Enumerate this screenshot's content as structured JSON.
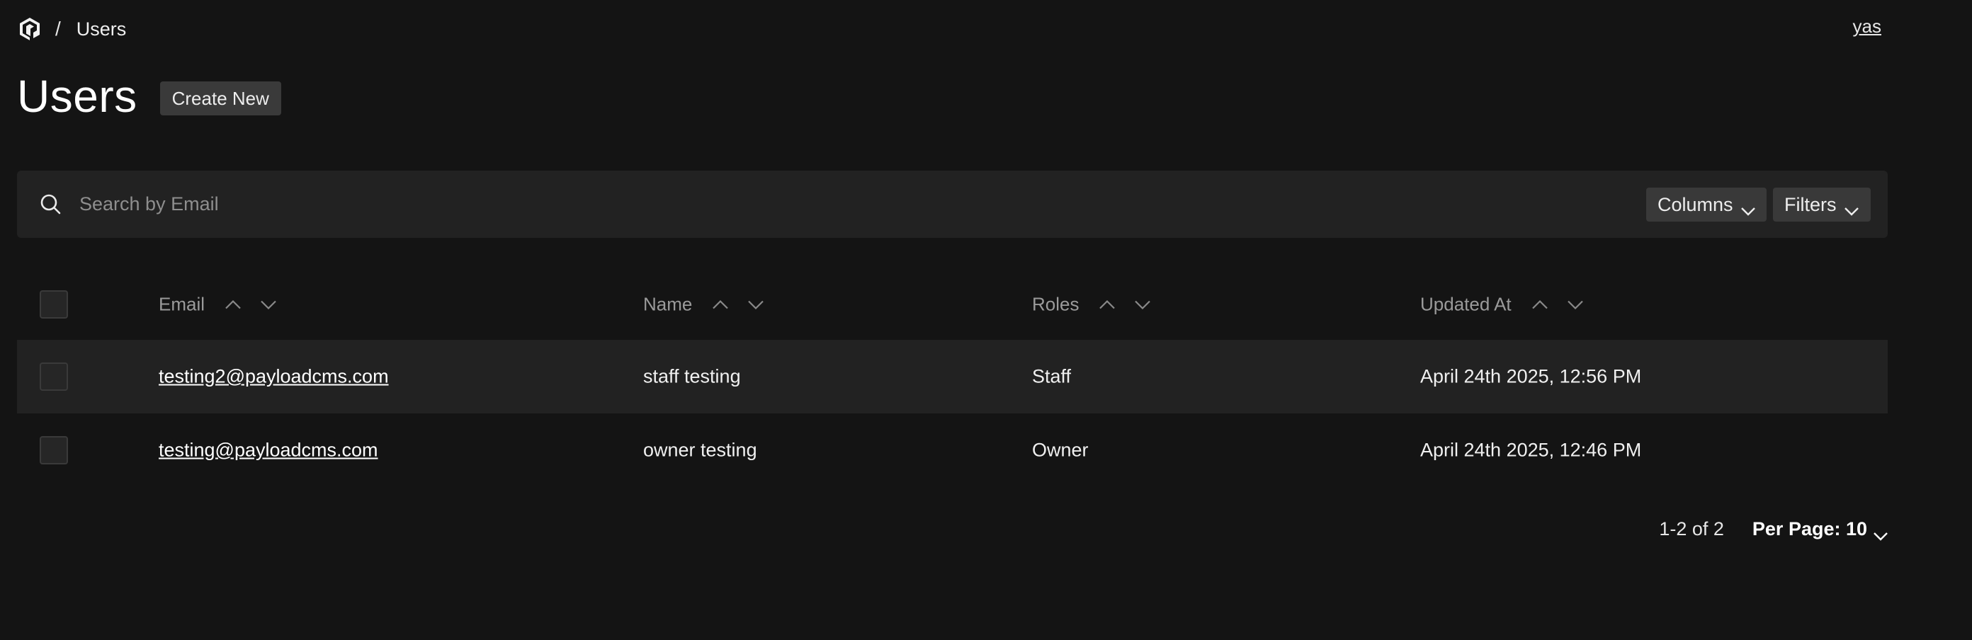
{
  "breadcrumb": {
    "separator": "/",
    "current": "Users"
  },
  "account": {
    "label": "yas"
  },
  "page": {
    "title": "Users",
    "create_button": "Create New"
  },
  "search": {
    "placeholder": "Search by Email",
    "value": ""
  },
  "toolbar": {
    "columns_label": "Columns",
    "filters_label": "Filters"
  },
  "table": {
    "columns": [
      "Email",
      "Name",
      "Roles",
      "Updated At"
    ],
    "rows": [
      {
        "email": "testing2@payloadcms.com",
        "name": "staff testing",
        "roles": "Staff",
        "updated_at": "April 24th 2025, 12:56 PM"
      },
      {
        "email": "testing@payloadcms.com",
        "name": "owner testing",
        "roles": "Owner",
        "updated_at": "April 24th 2025, 12:46 PM"
      }
    ]
  },
  "pagination": {
    "info": "1-2 of 2",
    "per_page": "Per Page: 10"
  },
  "icons": {
    "logo": "payload-logo-icon",
    "search": "search-icon",
    "chevron": "chevron-down-icon",
    "sort_asc": "sort-ascending-icon",
    "sort_desc": "sort-descending-icon"
  },
  "colors": {
    "background": "#141414",
    "surface": "#222222",
    "button": "#3a3a3a",
    "muted_text": "#9a9a9a"
  }
}
